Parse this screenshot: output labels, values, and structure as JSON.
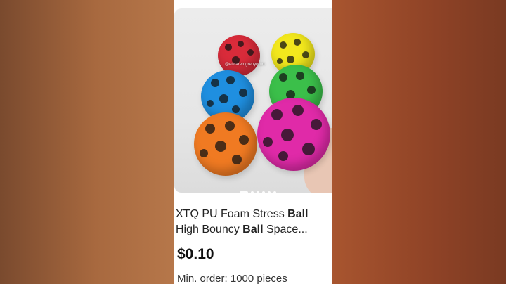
{
  "product": {
    "title_line1_pre": "XTQ PU Foam Stress ",
    "title_line1_bold": "Ball",
    "title_line2_pre": "High Bouncy ",
    "title_line2_bold": "Ball",
    "title_line2_post": " Space...",
    "price": "$0.10",
    "min_order": "Min. order: 1000 pieces"
  },
  "image": {
    "watermark": "@eticaretogrenyorum",
    "carousel_dots": 6,
    "active_dot": 0,
    "ball_colors": {
      "red": "#d92b3a",
      "yellow": "#f3e81d",
      "blue": "#1f8fe0",
      "green": "#3bbf4a",
      "orange": "#f07a22",
      "magenta": "#e02aa8"
    }
  }
}
